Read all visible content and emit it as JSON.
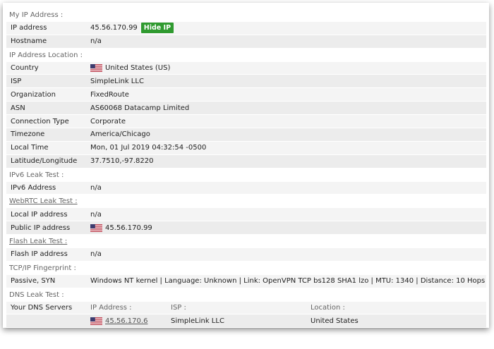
{
  "sections": {
    "my_ip": "My IP Address :",
    "location": "IP Address Location :",
    "ipv6": "IPv6 Leak Test :",
    "webrtc": "WebRTC Leak Test :",
    "flash": "Flash Leak Test :",
    "tcpip": "TCP/IP Fingerprint :",
    "dns": "DNS Leak Test :"
  },
  "ip": {
    "label": "IP address",
    "value": "45.56.170.99",
    "hide_button": "Hide IP",
    "hostname_label": "Hostname",
    "hostname_value": "n/a"
  },
  "location": {
    "country_label": "Country",
    "country_value": "United States (US)",
    "isp_label": "ISP",
    "isp_value": "SimpleLink LLC",
    "org_label": "Organization",
    "org_value": "FixedRoute",
    "asn_label": "ASN",
    "asn_value": "AS60068 Datacamp Limited",
    "conn_label": "Connection Type",
    "conn_value": "Corporate",
    "tz_label": "Timezone",
    "tz_value": "America/Chicago",
    "time_label": "Local Time",
    "time_value": "Mon, 01 Jul 2019 04:32:54 -0500",
    "latlon_label": "Latitude/Longitude",
    "latlon_value": "37.7510,-97.8220"
  },
  "ipv6": {
    "label": "IPv6 Address",
    "value": "n/a"
  },
  "webrtc": {
    "local_label": "Local IP address",
    "local_value": "n/a",
    "public_label": "Public IP address",
    "public_value": "45.56.170.99"
  },
  "flash": {
    "label": "Flash IP address",
    "value": "n/a"
  },
  "tcpip": {
    "label": "Passive, SYN",
    "value": "Windows NT kernel | Language: Unknown | Link: OpenVPN TCP bs128 SHA1 lzo | MTU: 1340 | Distance: 10 Hops"
  },
  "dns": {
    "label": "Your DNS Servers",
    "col_ip": "IP Address :",
    "col_isp": "ISP :",
    "col_location": "Location :",
    "row_ip": "45.56.170.6",
    "row_isp": "SimpleLink LLC",
    "row_location": "United States"
  },
  "icons": {
    "flag": "us-flag-icon"
  },
  "colors": {
    "hide_button": "#2f9a2f",
    "row_bg": "#f4f4f4"
  }
}
